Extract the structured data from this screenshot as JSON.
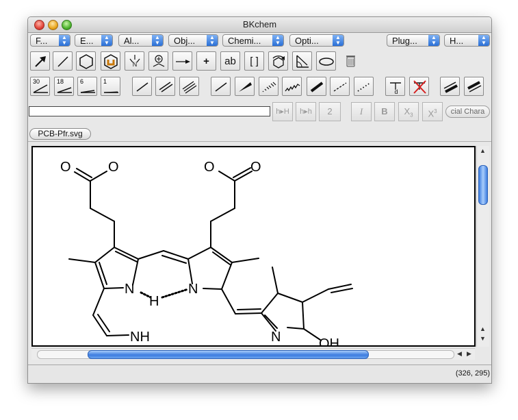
{
  "window": {
    "title": "BKchem"
  },
  "menus": [
    {
      "label": "F..."
    },
    {
      "label": "E..."
    },
    {
      "label": "Al..."
    },
    {
      "label": "Obj..."
    },
    {
      "label": "Chemi..."
    },
    {
      "label": "Opti..."
    },
    {
      "label": "Plug..."
    },
    {
      "label": "H..."
    }
  ],
  "toolbar": {
    "text_label": "ab",
    "plus_label": "+",
    "brackets_label": "[ ]"
  },
  "bond_angles": [
    "30",
    "18",
    "6",
    "1"
  ],
  "format": {
    "hh1": "h▸H",
    "hh2": "h▸h",
    "sub_sample": "2",
    "italic": "I",
    "bold": "B",
    "subscript": "X",
    "subscript_sup": "3",
    "superscript": "X",
    "superscript_sup": "3",
    "special_chars": "cial Chara"
  },
  "tab": {
    "label": "PCB-Pfr.svg"
  },
  "canvas_labels": {
    "o1": "O",
    "o2": "O",
    "o3": "O",
    "o4": "O",
    "n1": "N",
    "h1": "H",
    "n2": "N",
    "nh": "NH",
    "n3": "N",
    "oh": "OH"
  },
  "status": {
    "coords": "(326, 295)"
  },
  "colors": {
    "accent": "#3d7de0",
    "delete_red": "#d62020"
  }
}
